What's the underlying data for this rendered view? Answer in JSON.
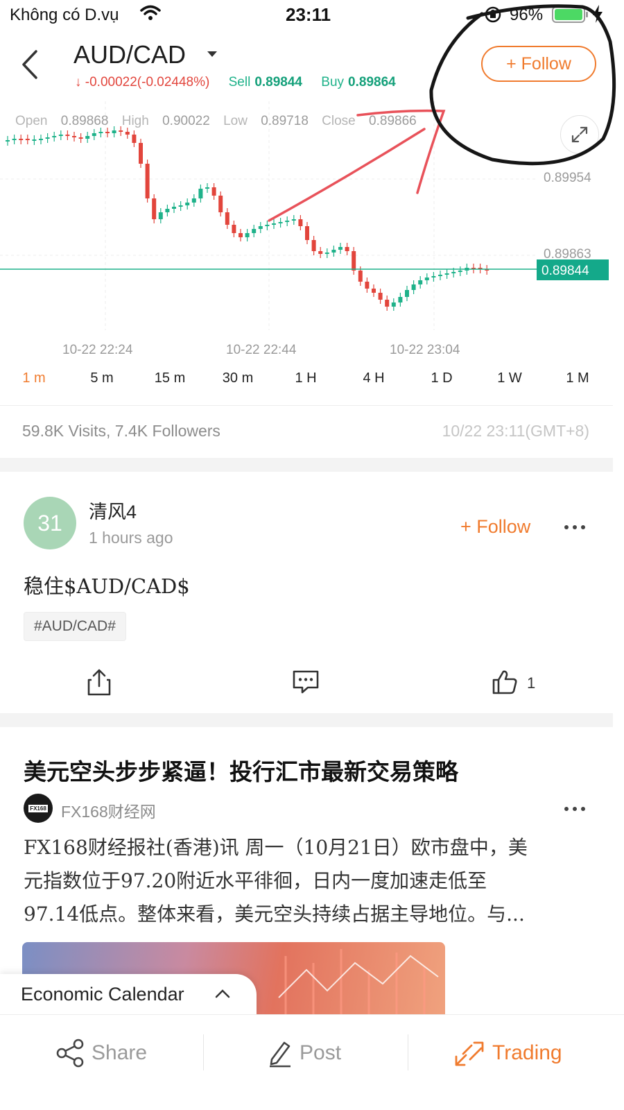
{
  "status_bar": {
    "carrier": "Không có D.vụ",
    "time": "23:11",
    "battery": "96%"
  },
  "header": {
    "title": "AUD/CAD",
    "change": "↓ -0.00022(-0.02448%)",
    "sell_label": "Sell",
    "sell_value": "0.89844",
    "buy_label": "Buy",
    "buy_value": "0.89864",
    "follow_label": "+ Follow"
  },
  "chart": {
    "open_label": "Open",
    "open_value": "0.89868",
    "high_label": "High",
    "high_value": "0.90022",
    "low_label": "Low",
    "low_value": "0.89718",
    "close_label": "Close",
    "close_value": "0.89866",
    "y_tick_1": "0.89954",
    "y_tick_2": "0.89863",
    "current_price": "0.89844",
    "x_ticks": [
      "10-22 22:24",
      "10-22 22:44",
      "10-22 23:04"
    ]
  },
  "timeframes": [
    "1 m",
    "5 m",
    "15 m",
    "30 m",
    "1 H",
    "4 H",
    "1 D",
    "1 W",
    "1 M"
  ],
  "active_timeframe": "1 m",
  "stats": {
    "visits_followers": "59.8K Visits, 7.4K Followers",
    "timestamp": "10/22 23:11(GMT+8)"
  },
  "post": {
    "avatar_text": "31",
    "user": "清风4",
    "time": "1 hours ago",
    "follow_label": "+ Follow",
    "text": "稳住$AUD/CAD$",
    "tag": "#AUD/CAD#",
    "like_count": "1"
  },
  "article": {
    "title": "美元空头步步紧逼！投行汇市最新交易策略",
    "source_logo": "FX168",
    "source": "FX168财经网",
    "body_lines": [
      "FX168财经报社(香港)讯 周一（10月21日）欧市盘中，美",
      "元指数位于97.20附近水平徘徊，日内一度加速走低至",
      "97.14低点。整体来看，美元空头持续占据主导地位。与..."
    ]
  },
  "economic_calendar": "Economic Calendar",
  "bottom_bar": {
    "share": "Share",
    "post": "Post",
    "trading": "Trading"
  },
  "colors": {
    "accent": "#f07b2e",
    "up": "#1fb28a",
    "down": "#e2453c"
  }
}
